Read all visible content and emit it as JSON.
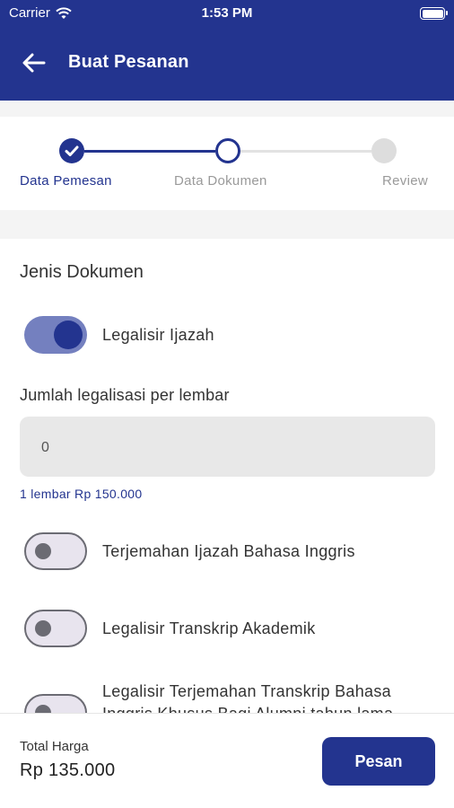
{
  "status_bar": {
    "carrier": "Carrier",
    "time": "1:53 PM"
  },
  "app_bar": {
    "title": "Buat Pesanan"
  },
  "stepper": {
    "steps": [
      {
        "label": "Data Pemesan",
        "state": "done"
      },
      {
        "label": "Data Dokumen",
        "state": "current"
      },
      {
        "label": "Review",
        "state": "pending"
      }
    ]
  },
  "form": {
    "section_title": "Jenis Dokumen",
    "documents": [
      {
        "label": "Legalisir Ijazah",
        "enabled": true
      },
      {
        "label": "Terjemahan Ijazah Bahasa Inggris",
        "enabled": false
      },
      {
        "label": "Legalisir Transkrip Akademik",
        "enabled": false
      },
      {
        "label": "Legalisir Terjemahan Transkrip Bahasa Inggris Khusus Bagi Alumni tahun lama",
        "enabled": false
      }
    ],
    "quantity_label": "Jumlah legalisasi per lembar",
    "quantity_value": "0",
    "price_hint": "1 lembar Rp 150.000"
  },
  "footer": {
    "total_label": "Total Harga",
    "total_value": "Rp 135.000",
    "order_button": "Pesan"
  },
  "colors": {
    "primary": "#23348f",
    "toggle_track_on": "#7480bf",
    "toggle_off": "#6b6b73",
    "step_pending": "#dddddd"
  }
}
